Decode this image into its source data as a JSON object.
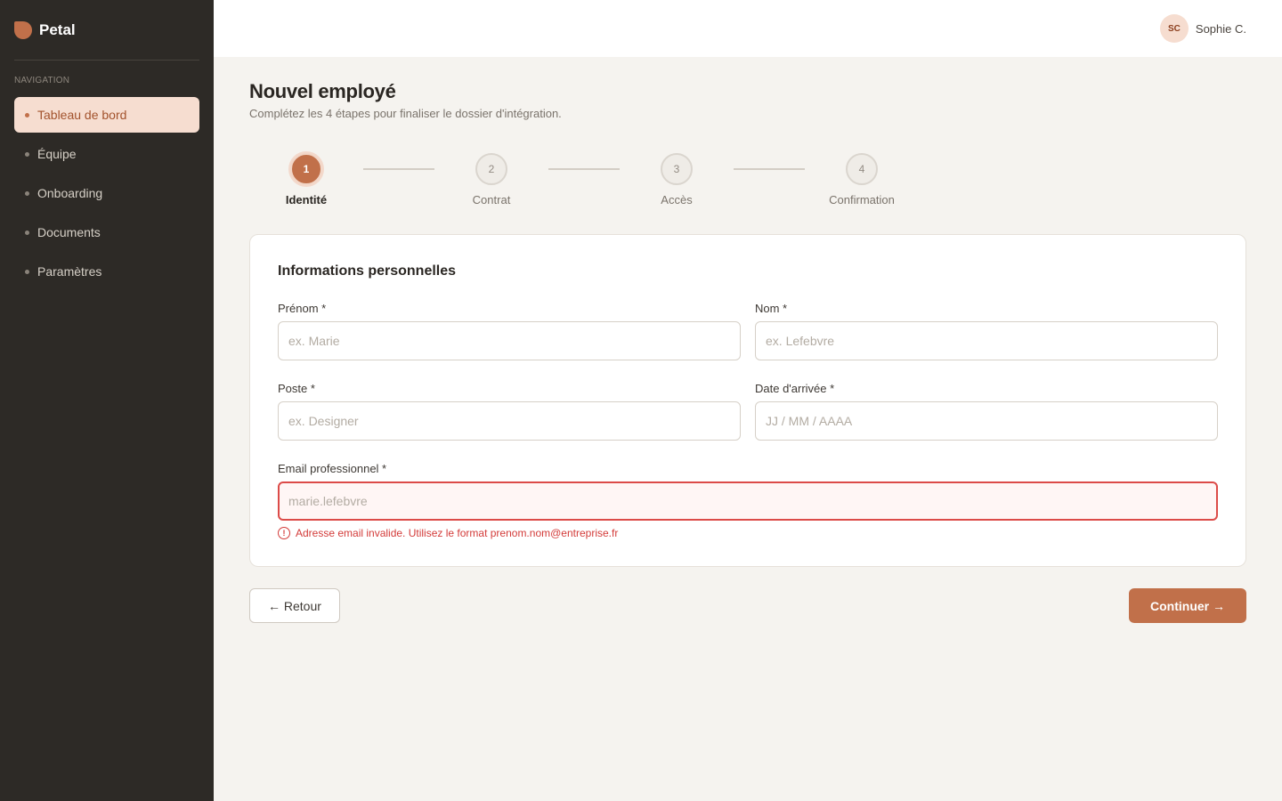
{
  "brand": {
    "name": "Petal"
  },
  "sidebar": {
    "heading": "NAVIGATION",
    "items": [
      {
        "label": "Tableau de bord",
        "active": true
      },
      {
        "label": "Équipe"
      },
      {
        "label": "Onboarding"
      },
      {
        "label": "Documents"
      },
      {
        "label": "Paramètres"
      }
    ]
  },
  "header": {
    "user_initials": "SC",
    "user_name": "Sophie C."
  },
  "page": {
    "title": "Nouvel employé",
    "subtitle": "Complétez les 4 étapes pour finaliser le dossier d'intégration."
  },
  "stepper": {
    "current_step": 1,
    "steps": [
      {
        "number": "1",
        "label": "Identité"
      },
      {
        "number": "2",
        "label": "Contrat"
      },
      {
        "number": "3",
        "label": "Accès"
      },
      {
        "number": "4",
        "label": "Confirmation"
      }
    ]
  },
  "form": {
    "title": "Informations personnelles",
    "fields": {
      "first_name": {
        "label": "Prénom *",
        "placeholder": "ex. Marie",
        "value": ""
      },
      "last_name": {
        "label": "Nom *",
        "placeholder": "ex. Lefebvre",
        "value": ""
      },
      "position": {
        "label": "Poste *",
        "placeholder": "ex. Designer",
        "value": ""
      },
      "start_date": {
        "label": "Date d'arrivée *",
        "placeholder": "JJ / MM / AAAA",
        "value": ""
      },
      "email": {
        "label": "Email professionnel *",
        "placeholder": "marie.lefebvre",
        "value": "",
        "error": "Adresse email invalide. Utilisez le format prenom.nom@entreprise.fr",
        "error_icon": "!"
      }
    }
  },
  "actions": {
    "back_label": "← Retour",
    "next_label": "Continuer →"
  },
  "colors": {
    "accent": "#c1704a",
    "sidebar_bg": "#2d2a26",
    "error": "#dc4b48",
    "page_bg": "#f5f3ef"
  }
}
